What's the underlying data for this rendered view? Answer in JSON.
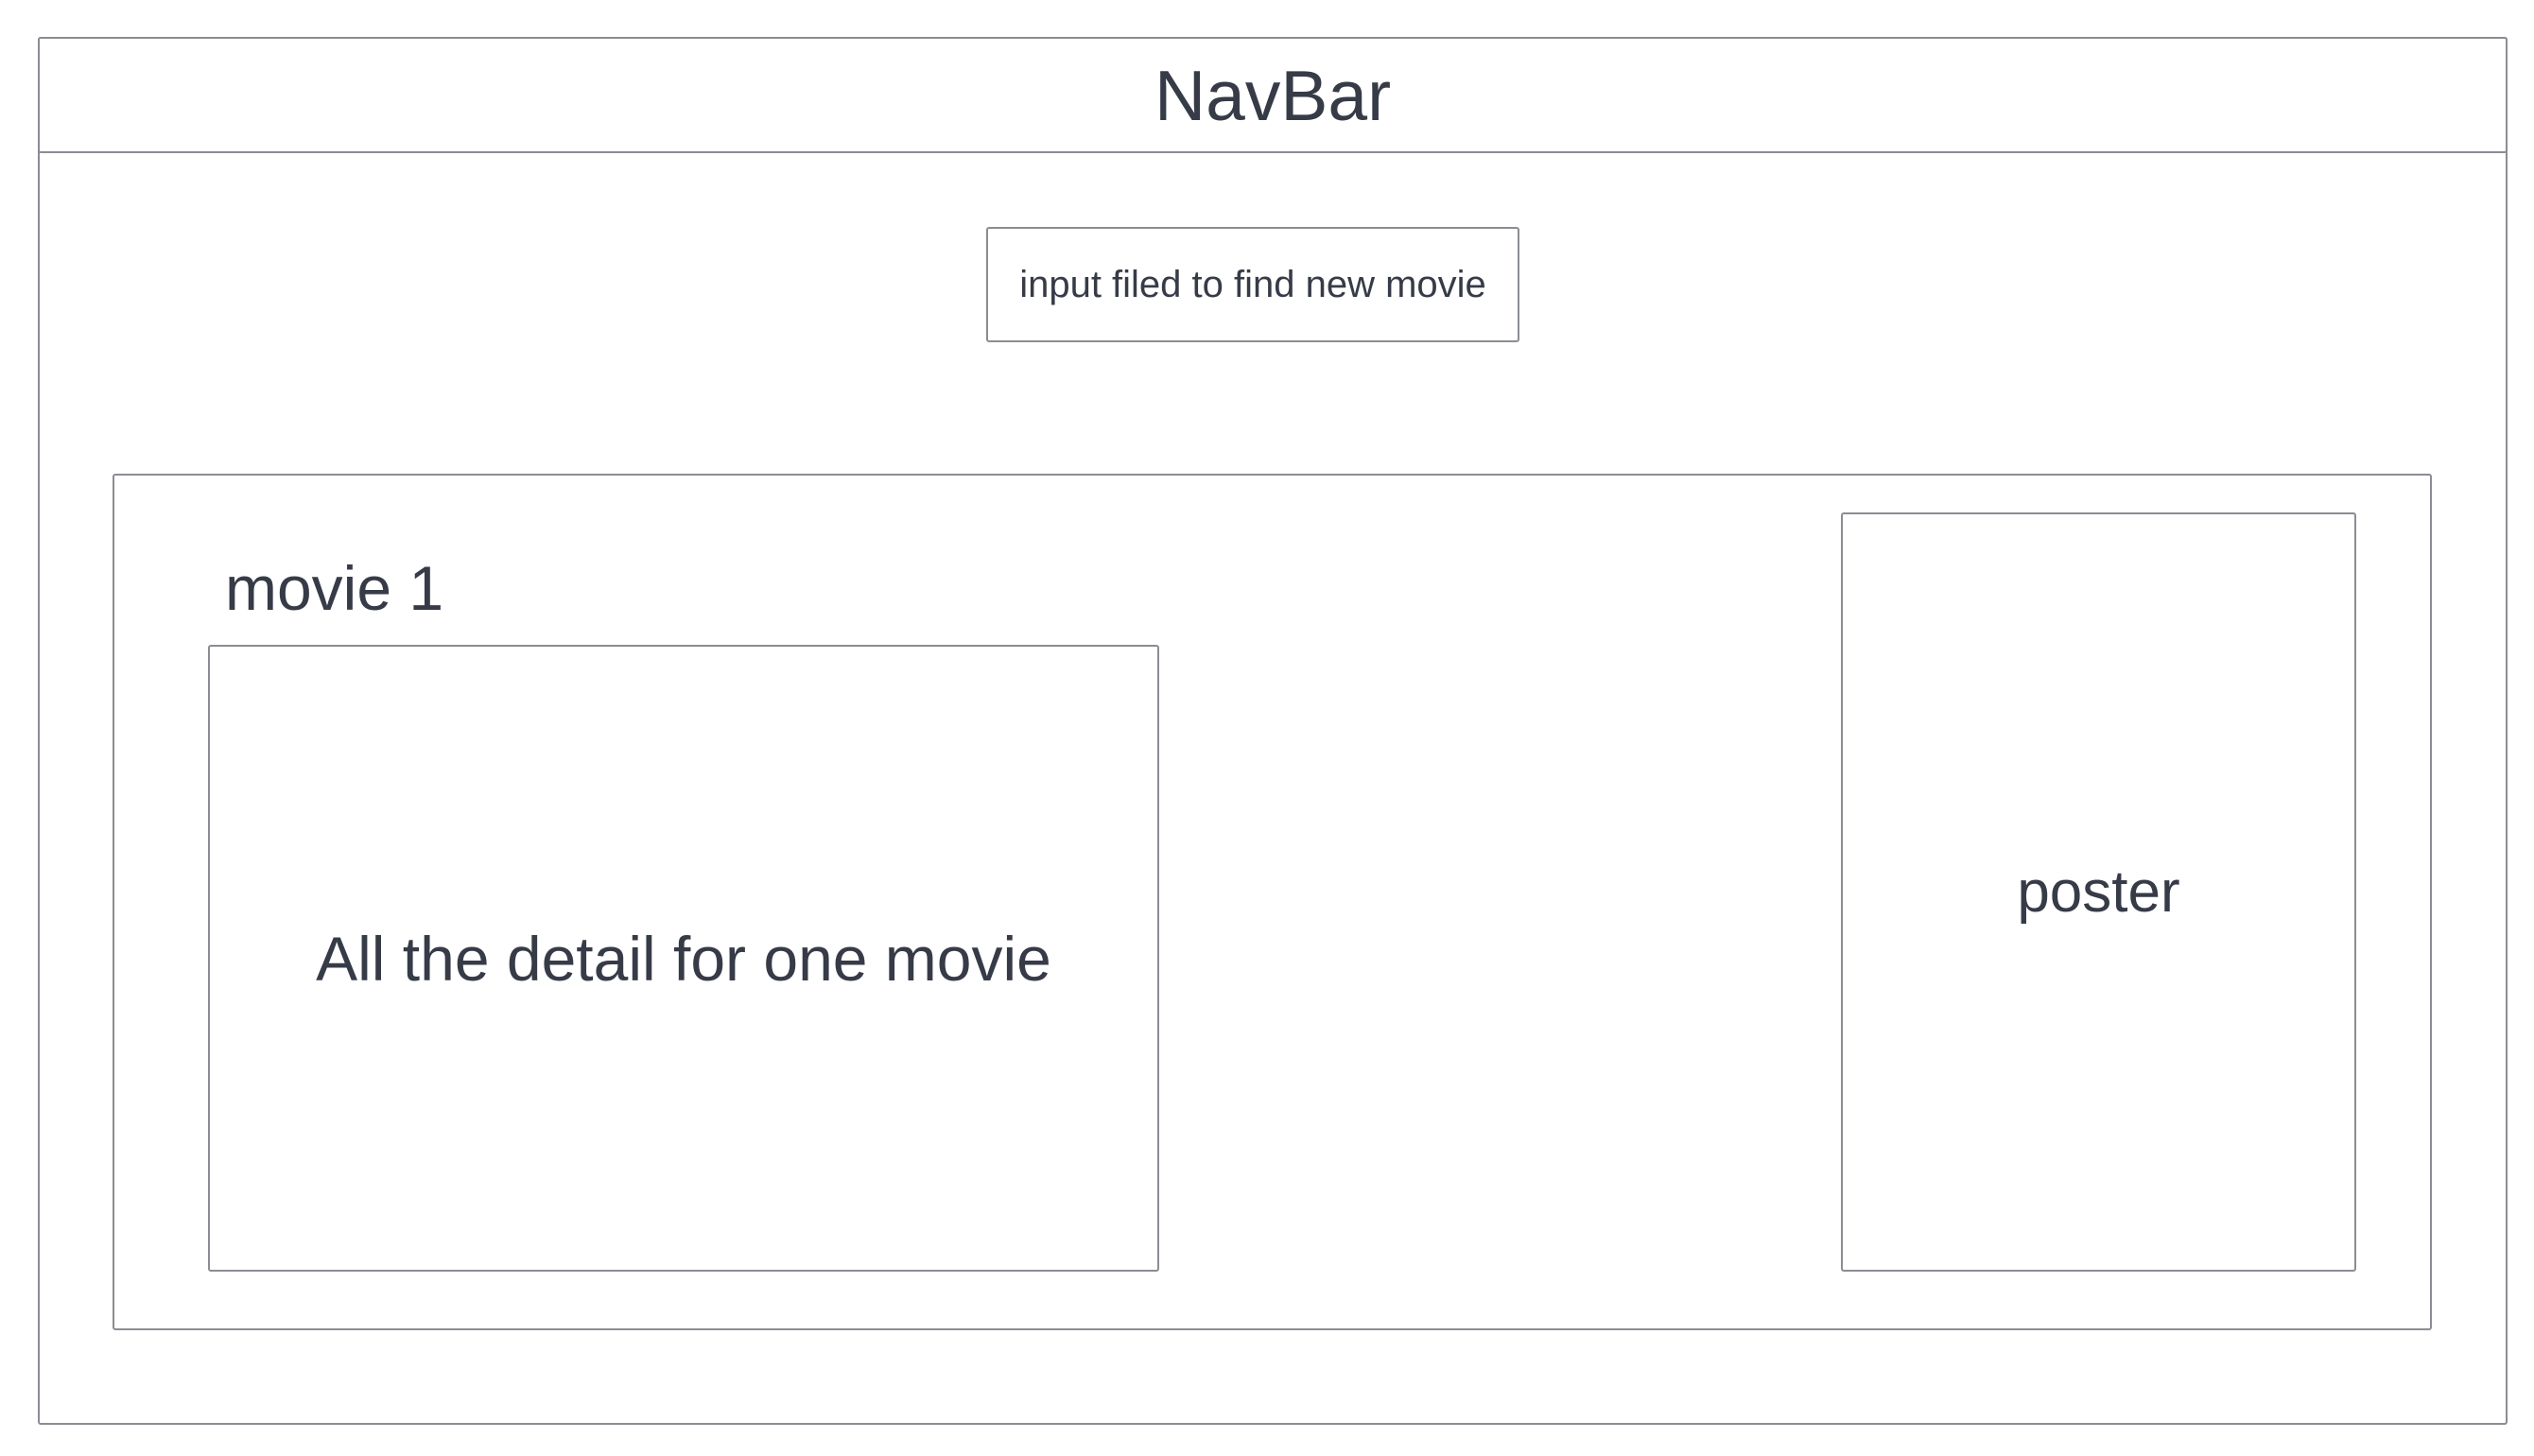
{
  "navbar": {
    "label": "NavBar"
  },
  "search": {
    "label": "input filed to find new movie"
  },
  "movie": {
    "title": "movie 1",
    "detail_label": "All the detail for one movie",
    "poster_label": "poster"
  },
  "colors": {
    "border": "#8a8d93",
    "text": "#363b47",
    "background": "#ffffff"
  }
}
